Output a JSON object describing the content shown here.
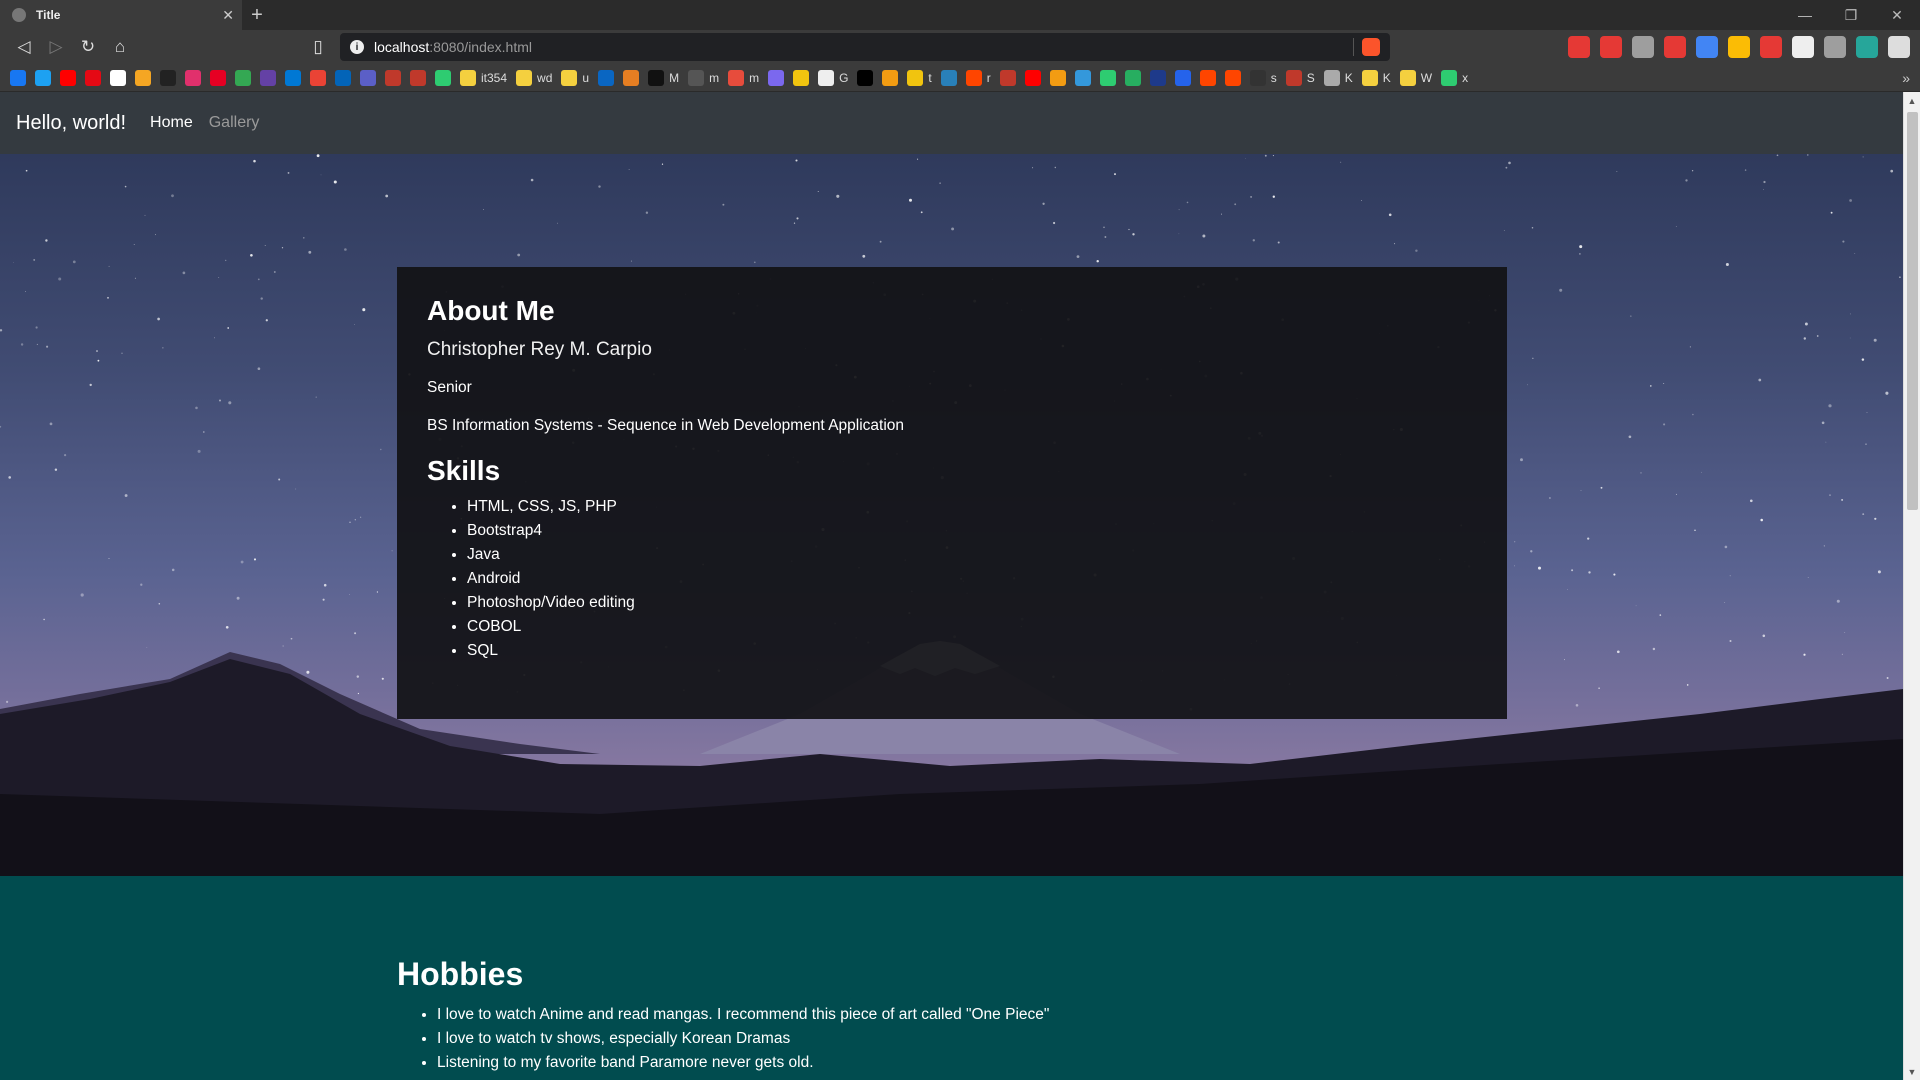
{
  "browser": {
    "tab_title": "Title",
    "url_host": "localhost",
    "url_path": ":8080/index.html",
    "bookmarks": [
      {
        "label": "",
        "color": "#1877f2"
      },
      {
        "label": "",
        "color": "#1da1f2"
      },
      {
        "label": "",
        "color": "#ff0000"
      },
      {
        "label": "",
        "color": "#e50914"
      },
      {
        "label": "",
        "color": "#ffffff"
      },
      {
        "label": "",
        "color": "#f5a623"
      },
      {
        "label": "",
        "color": "#222222"
      },
      {
        "label": "",
        "color": "#e1306c"
      },
      {
        "label": "",
        "color": "#e60023"
      },
      {
        "label": "",
        "color": "#34a853"
      },
      {
        "label": "",
        "color": "#6441a5"
      },
      {
        "label": "",
        "color": "#0078d4"
      },
      {
        "label": "",
        "color": "#ea4335"
      },
      {
        "label": "",
        "color": "#0364b8"
      },
      {
        "label": "",
        "color": "#5b5fc7"
      },
      {
        "label": "",
        "color": "#c0392b"
      },
      {
        "label": "",
        "color": "#c0392b"
      },
      {
        "label": "",
        "color": "#2ecc71"
      },
      {
        "label": "it354",
        "color": "#f4d03f"
      },
      {
        "label": "wd",
        "color": "#f4d03f"
      },
      {
        "label": "u",
        "color": "#f4d03f"
      },
      {
        "label": "",
        "color": "#0a66c2"
      },
      {
        "label": "",
        "color": "#e67e22"
      },
      {
        "label": "M",
        "color": "#111111"
      },
      {
        "label": "m",
        "color": "#555555"
      },
      {
        "label": "m",
        "color": "#e74c3c"
      },
      {
        "label": "",
        "color": "#7b68ee"
      },
      {
        "label": "",
        "color": "#f1c40f"
      },
      {
        "label": "G",
        "color": "#eeeeee"
      },
      {
        "label": "",
        "color": "#000000"
      },
      {
        "label": "",
        "color": "#f39c12"
      },
      {
        "label": "t",
        "color": "#f1c40f"
      },
      {
        "label": "",
        "color": "#2980b9"
      },
      {
        "label": "r",
        "color": "#ff4500"
      },
      {
        "label": "",
        "color": "#c0392b"
      },
      {
        "label": "",
        "color": "#ff0000"
      },
      {
        "label": "",
        "color": "#f39c12"
      },
      {
        "label": "",
        "color": "#3498db"
      },
      {
        "label": "",
        "color": "#2ecc71"
      },
      {
        "label": "",
        "color": "#27ae60"
      },
      {
        "label": "",
        "color": "#1e3a8a"
      },
      {
        "label": "",
        "color": "#2563eb"
      },
      {
        "label": "",
        "color": "#ff4500"
      },
      {
        "label": "",
        "color": "#ff4500"
      },
      {
        "label": "s",
        "color": "#333333"
      },
      {
        "label": "S",
        "color": "#c0392b"
      },
      {
        "label": "K",
        "color": "#aaaaaa"
      },
      {
        "label": "K",
        "color": "#f4d03f"
      },
      {
        "label": "W",
        "color": "#f4d03f"
      },
      {
        "label": "x",
        "color": "#2ecc71"
      }
    ],
    "extensions": [
      "#e53935",
      "#e53935",
      "#9e9e9e",
      "#e53935",
      "#4285f4",
      "#fbbc05",
      "#e53935",
      "#eeeeee",
      "#9e9e9e",
      "#26a69a",
      "#dddddd"
    ]
  },
  "site": {
    "brand": "Hello, world!",
    "nav": [
      "Home",
      "Gallery"
    ]
  },
  "about": {
    "heading": "About Me",
    "name": "Christopher Rey M. Carpio",
    "year": "Senior",
    "program": "BS Information Systems - Sequence in Web Development Application",
    "skills_heading": "Skills",
    "skills": [
      "HTML, CSS, JS, PHP",
      "Bootstrap4",
      "Java",
      "Android",
      "Photoshop/Video editing",
      "COBOL",
      "SQL"
    ]
  },
  "hobbies": {
    "heading": "Hobbies",
    "items": [
      "I love to watch Anime and read mangas. I recommend this piece of art called \"One Piece\"",
      "I love to watch tv shows, especially Korean Dramas",
      "Listening to my favorite band Paramore never gets old."
    ]
  }
}
